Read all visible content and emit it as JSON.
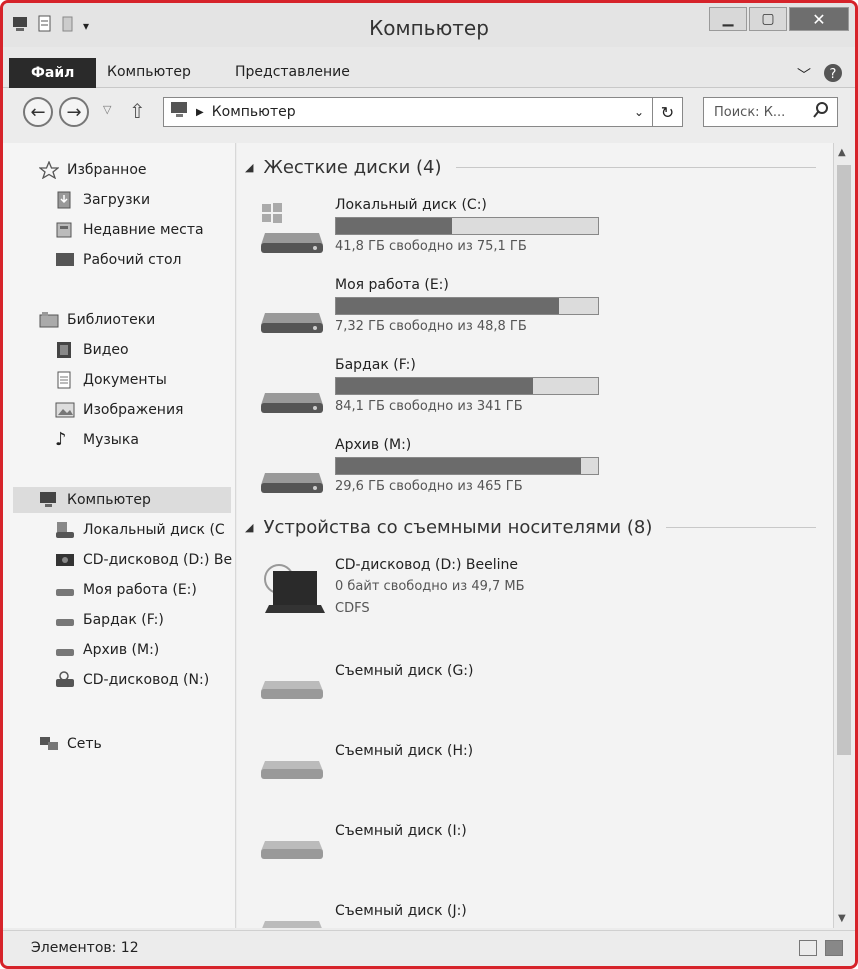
{
  "window": {
    "title": "Компьютер"
  },
  "ribbon": {
    "tabs": [
      "Файл",
      "Компьютер",
      "Представление"
    ]
  },
  "nav": {
    "address": "Компьютер",
    "search_placeholder": "Поиск: К..."
  },
  "sidebar": {
    "favorites": {
      "label": "Избранное",
      "items": [
        "Загрузки",
        "Недавние места",
        "Рабочий стол"
      ]
    },
    "libraries": {
      "label": "Библиотеки",
      "items": [
        "Видео",
        "Документы",
        "Изображения",
        "Музыка"
      ]
    },
    "computer": {
      "label": "Компьютер",
      "items": [
        "Локальный диск (C",
        "CD-дисковод (D:) Be",
        "Моя работа (E:)",
        "Бардак (F:)",
        "Архив (M:)",
        "CD-дисковод (N:)"
      ]
    },
    "network": {
      "label": "Сеть"
    }
  },
  "content": {
    "hard_disks": {
      "heading": "Жесткие диски (4)",
      "drives": [
        {
          "name": "Локальный диск (C:)",
          "free": "41,8 ГБ свободно из 75,1 ГБ",
          "used_fraction": 0.443
        },
        {
          "name": "Моя работа (E:)",
          "free": "7,32 ГБ свободно из 48,8 ГБ",
          "used_fraction": 0.85
        },
        {
          "name": "Бардак (F:)",
          "free": "84,1 ГБ свободно из 341 ГБ",
          "used_fraction": 0.753
        },
        {
          "name": "Архив (M:)",
          "free": "29,6 ГБ свободно из 465 ГБ",
          "used_fraction": 0.936
        }
      ]
    },
    "removable": {
      "heading": "Устройства со съемными носителями (8)",
      "cd": {
        "name": "CD-дисковод (D:) Beeline",
        "free": "0 байт свободно из 49,7 МБ",
        "fs": "CDFS"
      },
      "drives": [
        "Съемный диск (G:)",
        "Съемный диск (H:)",
        "Съемный диск (I:)",
        "Съемный диск (J:)"
      ]
    }
  },
  "status": {
    "items": "Элементов: 12"
  },
  "colors": {
    "frame": "#d6232a",
    "bar_fill": "#6b6b6b",
    "bar_bg": "#dcdcdc"
  }
}
